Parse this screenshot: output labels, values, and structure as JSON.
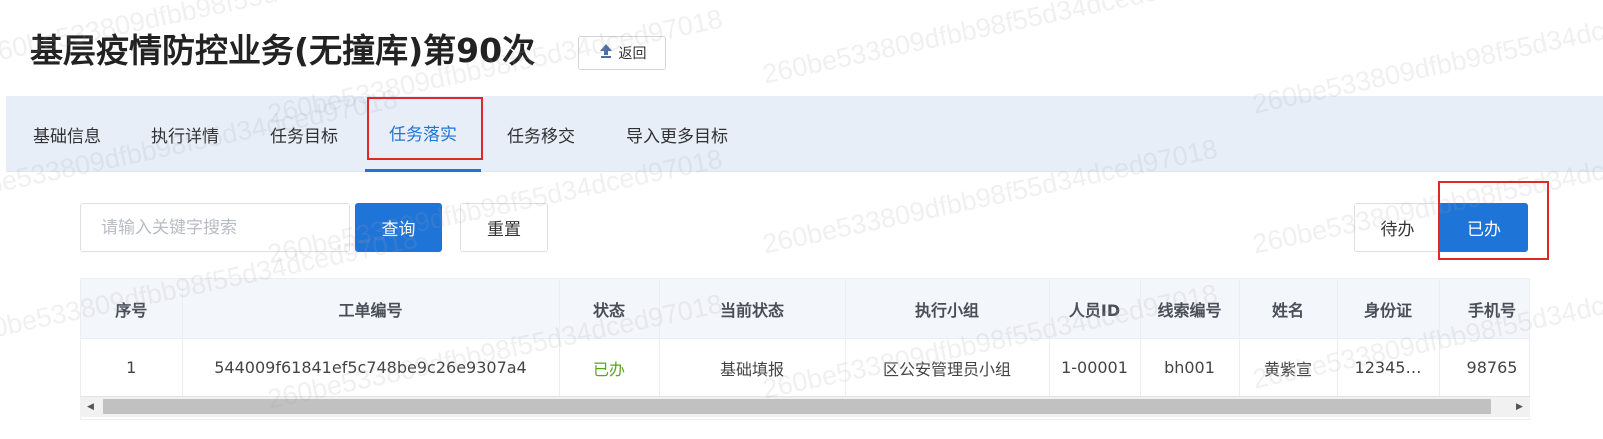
{
  "header": {
    "title": "基层疫情防控业务(无撞库)第90次",
    "back_label": "返回"
  },
  "tabs": [
    {
      "label": "基础信息"
    },
    {
      "label": "执行详情"
    },
    {
      "label": "任务目标"
    },
    {
      "label": "任务落实",
      "active": true
    },
    {
      "label": "任务移交"
    },
    {
      "label": "导入更多目标"
    }
  ],
  "filter": {
    "search_placeholder": "请输入关键字搜索",
    "search_value": "",
    "query_label": "查询",
    "reset_label": "重置",
    "todo_label": "待办",
    "done_label": "已办",
    "selected": "已办"
  },
  "table": {
    "columns": [
      "序号",
      "工单编号",
      "状态",
      "当前状态",
      "执行小组",
      "人员ID",
      "线索编号",
      "姓名",
      "身份证",
      "手机号"
    ],
    "rows": [
      [
        "1",
        "544009f61841ef5c748be9c26e9307a4",
        "已办",
        "基础填报",
        "区公安管理员小组",
        "1-00001",
        "bh001",
        "黄紫宣",
        "12345…",
        "98765"
      ]
    ]
  },
  "watermark": "260be533809dfbb98f55d34dced97018",
  "colors": {
    "accent": "#1f74d8",
    "tab_bar_bg": "#e7eef8",
    "status_done": "#5aa520",
    "highlight": "#e02828"
  }
}
